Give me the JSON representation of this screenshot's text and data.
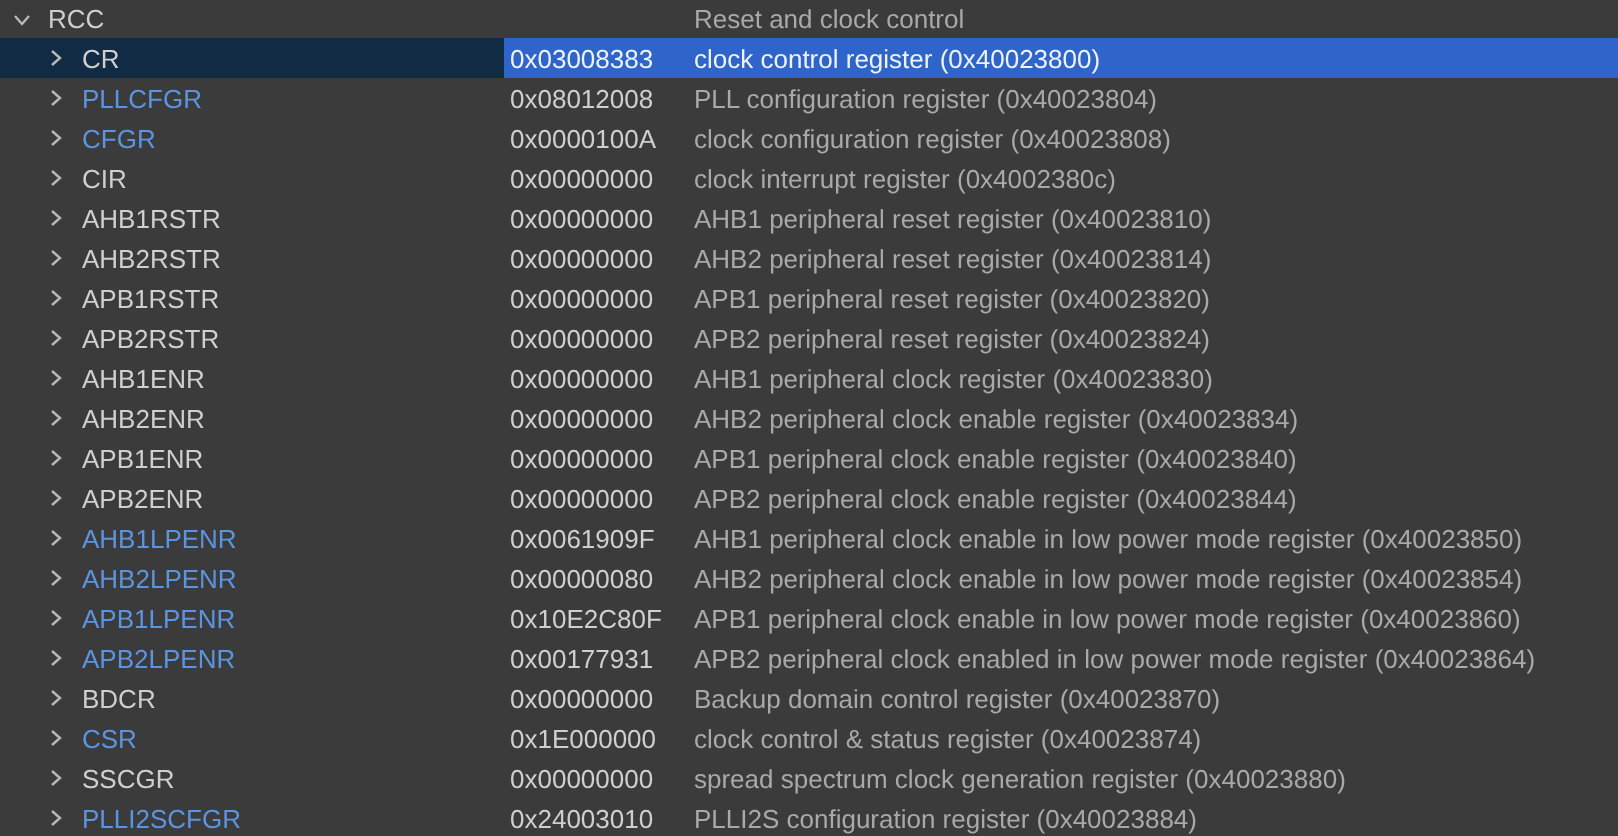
{
  "tree": {
    "name": "RCC",
    "description": "Reset and clock control",
    "expanded": true,
    "children": [
      {
        "name": "CR",
        "value": "0x03008383",
        "description": "clock control register (0x40023800)",
        "changed": false,
        "selected": true,
        "expanded": false
      },
      {
        "name": "PLLCFGR",
        "value": "0x08012008",
        "description": "PLL configuration register (0x40023804)",
        "changed": true,
        "selected": false,
        "expanded": false
      },
      {
        "name": "CFGR",
        "value": "0x0000100A",
        "description": "clock configuration register (0x40023808)",
        "changed": true,
        "selected": false,
        "expanded": false
      },
      {
        "name": "CIR",
        "value": "0x00000000",
        "description": "clock interrupt register (0x4002380c)",
        "changed": false,
        "selected": false,
        "expanded": false
      },
      {
        "name": "AHB1RSTR",
        "value": "0x00000000",
        "description": "AHB1 peripheral reset register (0x40023810)",
        "changed": false,
        "selected": false,
        "expanded": false
      },
      {
        "name": "AHB2RSTR",
        "value": "0x00000000",
        "description": "AHB2 peripheral reset register (0x40023814)",
        "changed": false,
        "selected": false,
        "expanded": false
      },
      {
        "name": "APB1RSTR",
        "value": "0x00000000",
        "description": "APB1 peripheral reset register (0x40023820)",
        "changed": false,
        "selected": false,
        "expanded": false
      },
      {
        "name": "APB2RSTR",
        "value": "0x00000000",
        "description": "APB2 peripheral reset register (0x40023824)",
        "changed": false,
        "selected": false,
        "expanded": false
      },
      {
        "name": "AHB1ENR",
        "value": "0x00000000",
        "description": "AHB1 peripheral clock register (0x40023830)",
        "changed": false,
        "selected": false,
        "expanded": false
      },
      {
        "name": "AHB2ENR",
        "value": "0x00000000",
        "description": "AHB2 peripheral clock enable register (0x40023834)",
        "changed": false,
        "selected": false,
        "expanded": false
      },
      {
        "name": "APB1ENR",
        "value": "0x00000000",
        "description": "APB1 peripheral clock enable register (0x40023840)",
        "changed": false,
        "selected": false,
        "expanded": false
      },
      {
        "name": "APB2ENR",
        "value": "0x00000000",
        "description": "APB2 peripheral clock enable register (0x40023844)",
        "changed": false,
        "selected": false,
        "expanded": false
      },
      {
        "name": "AHB1LPENR",
        "value": "0x0061909F",
        "description": "AHB1 peripheral clock enable in low power mode register (0x40023850)",
        "changed": true,
        "selected": false,
        "expanded": false
      },
      {
        "name": "AHB2LPENR",
        "value": "0x00000080",
        "description": "AHB2 peripheral clock enable in low power mode register (0x40023854)",
        "changed": true,
        "selected": false,
        "expanded": false
      },
      {
        "name": "APB1LPENR",
        "value": "0x10E2C80F",
        "description": "APB1 peripheral clock enable in low power mode register (0x40023860)",
        "changed": true,
        "selected": false,
        "expanded": false
      },
      {
        "name": "APB2LPENR",
        "value": "0x00177931",
        "description": "APB2 peripheral clock enabled in low power mode register (0x40023864)",
        "changed": true,
        "selected": false,
        "expanded": false
      },
      {
        "name": "BDCR",
        "value": "0x00000000",
        "description": "Backup domain control register (0x40023870)",
        "changed": false,
        "selected": false,
        "expanded": false
      },
      {
        "name": "CSR",
        "value": "0x1E000000",
        "description": "clock control & status register (0x40023874)",
        "changed": true,
        "selected": false,
        "expanded": false
      },
      {
        "name": "SSCGR",
        "value": "0x00000000",
        "description": "spread spectrum clock generation register (0x40023880)",
        "changed": false,
        "selected": false,
        "expanded": false
      },
      {
        "name": "PLLI2SCFGR",
        "value": "0x24003010",
        "description": "PLLI2S configuration register (0x40023884)",
        "changed": true,
        "selected": false,
        "expanded": false
      }
    ]
  }
}
